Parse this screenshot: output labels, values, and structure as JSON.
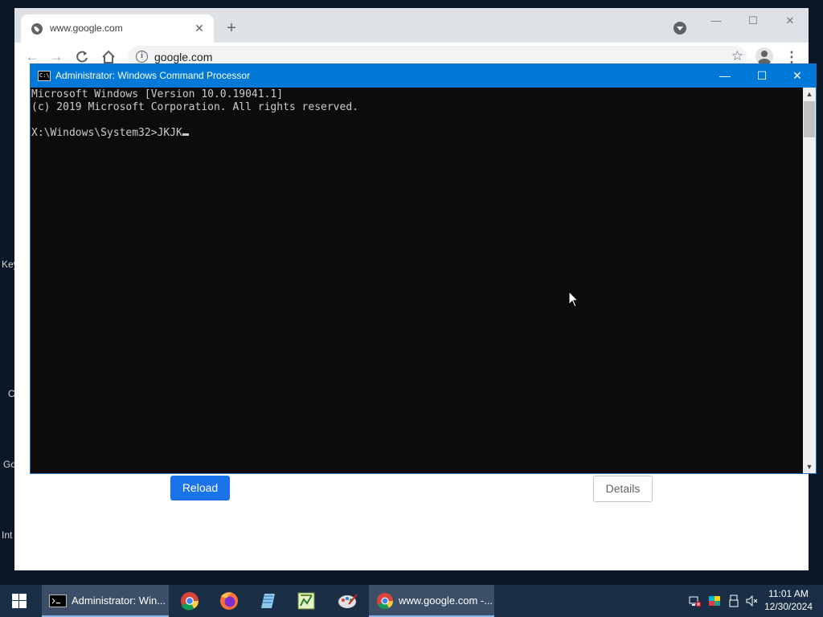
{
  "desktop": {
    "labels": [
      "Key",
      "C",
      "Go",
      "Int"
    ]
  },
  "chrome": {
    "tab_title": "www.google.com",
    "url": "google.com",
    "new_tab_label": "+",
    "error_page": {
      "reload_label": "Reload",
      "details_label": "Details"
    }
  },
  "cmd": {
    "title": "Administrator: Windows Command Processor",
    "lines": [
      "Microsoft Windows [Version 10.0.19041.1]",
      "(c) 2019 Microsoft Corporation. All rights reserved.",
      "",
      "X:\\Windows\\System32>JKJK"
    ],
    "icon_text": "C:\\"
  },
  "taskbar": {
    "items": [
      {
        "label": "Administrator: Win...",
        "icon": "cmd-icon",
        "active": true
      },
      {
        "label": "www.google.com -...",
        "icon": "chrome-icon",
        "active": false
      }
    ],
    "pinned": [
      "chrome-icon",
      "firefox-icon",
      "notepad-icon",
      "spreadsheet-icon",
      "paint-icon"
    ],
    "tray": [
      "network-icon",
      "color-app-icon",
      "usb-icon",
      "volume-muted-icon"
    ],
    "clock": {
      "time": "11:01 AM",
      "date": "12/30/2024"
    }
  },
  "colors": {
    "cmd_titlebar": "#0078d7",
    "taskbar": "#1a2e45",
    "reload_button": "#1a73e8"
  }
}
